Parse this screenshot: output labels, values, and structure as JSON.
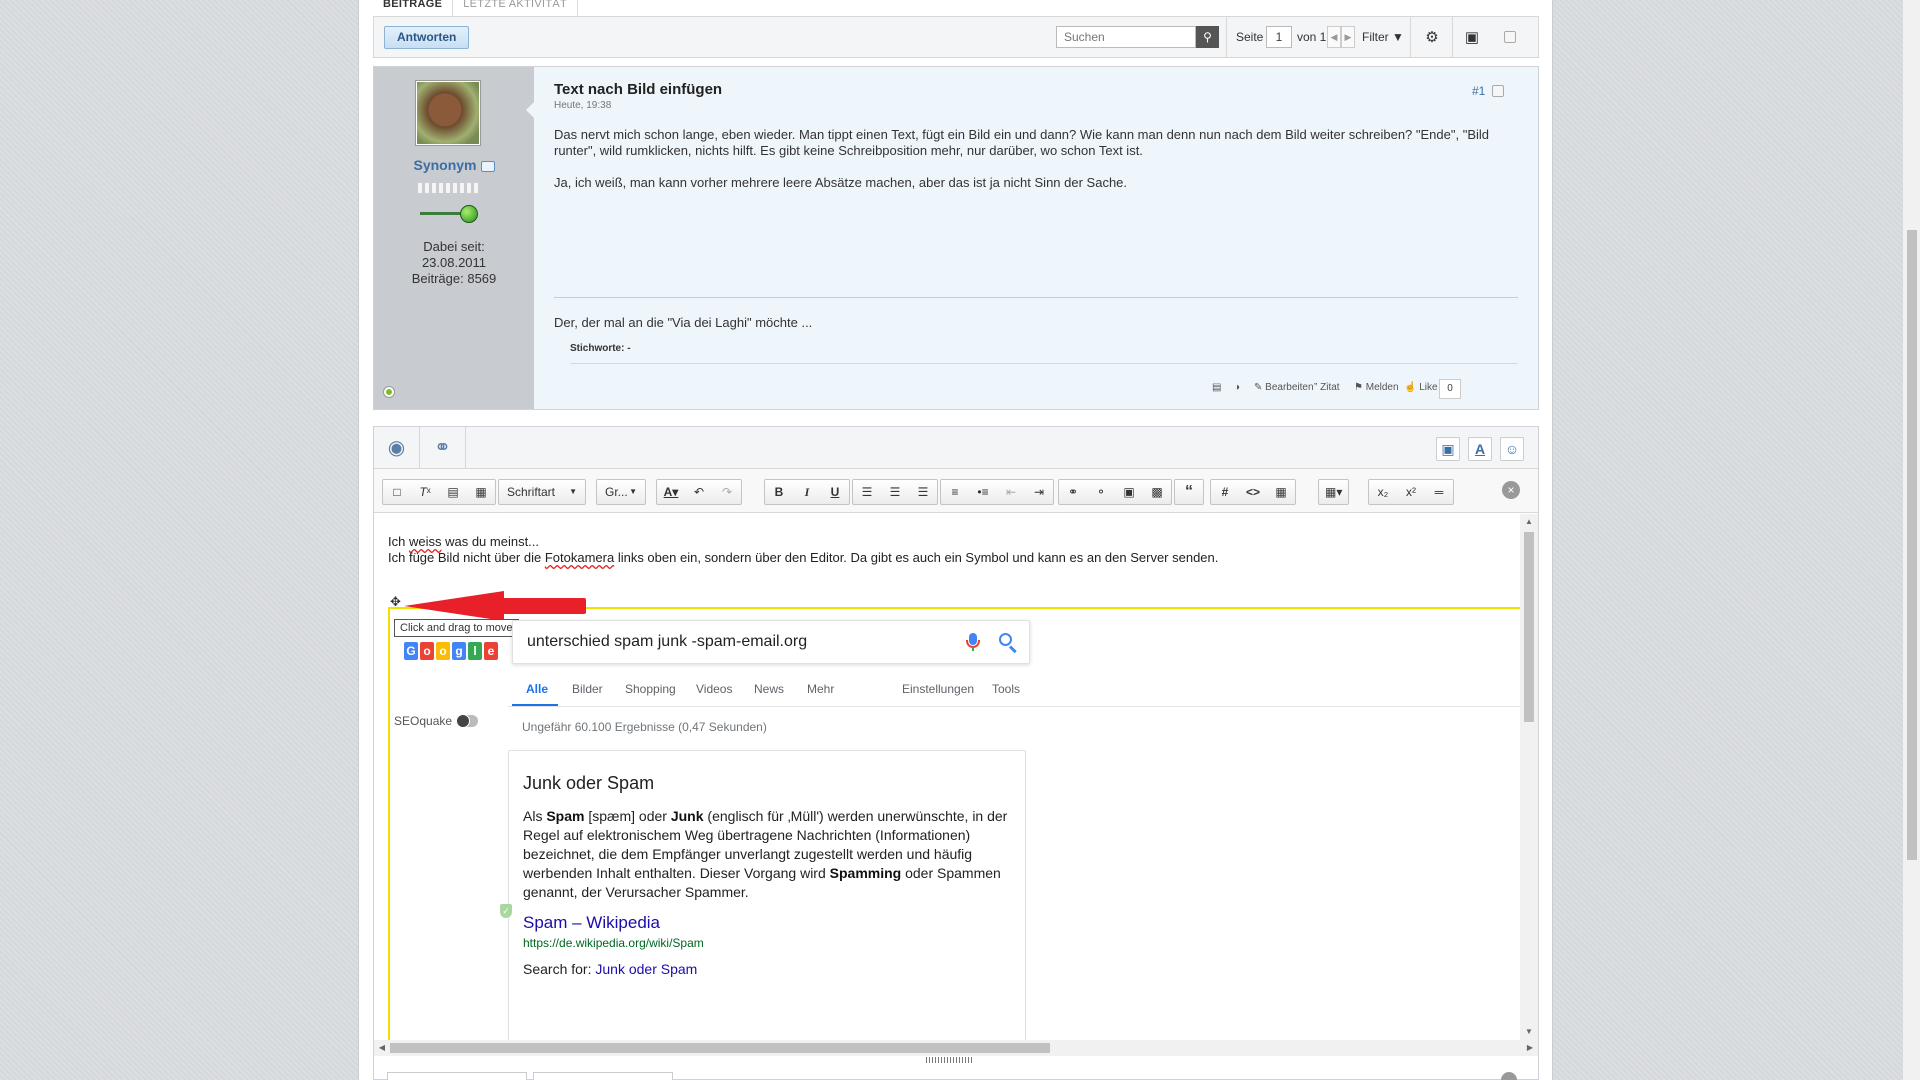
{
  "tabs": [
    "Beiträge",
    "Letzte Aktivität"
  ],
  "toolbar": {
    "reply_label": "Antworten",
    "search_placeholder": "Suchen",
    "page_label": "Seite",
    "page_value": "1",
    "of_label": "von 1",
    "filter_label": "Filter"
  },
  "post": {
    "username": "Synonym",
    "joined_label": "Dabei seit:",
    "joined_date": "23.08.2011",
    "posts_label": "Beiträge: 8569",
    "title": "Text nach Bild einfügen",
    "date": "Heute, 19:38",
    "number": "#1",
    "paragraphs": [
      "Das nervt mich schon lange, eben wieder. Man tippt einen Text, fügt ein Bild ein und dann? Wie kann man denn nun nach dem Bild weiter schreiben? \"Ende\", \"Bild runter\", wild rumklicken, nichts hilft. Es gibt keine Schreibposition mehr, nur darüber, wo schon Text ist.",
      "Ja, ich weiß, man kann vorher mehrere leere Absätze machen, aber das ist ja nicht Sinn der Sache."
    ],
    "signature": "Der, der mal an die \"Via dei Laghi\" möchte ...",
    "tags": "Stichworte: -",
    "actions": {
      "edit": "Bearbeiten",
      "quote": "Zitat",
      "report": "Melden",
      "like": "Like",
      "like_count": "0"
    }
  },
  "editor": {
    "font_dropdown": "Schriftart",
    "size_dropdown": "Gr...",
    "content_line1_a": "Ich ",
    "content_line1_sp": "weiss",
    "content_line1_b": " was du meinst...",
    "content_line2_a": "Ich füge Bild nicht über die ",
    "content_line2_sp": "Fotokamera",
    "content_line2_b": " links oben ein, sondern über den Editor. Da gibt es auch ein Symbol und kann es an den Server senden.",
    "tooltip": "Click and drag to move"
  },
  "google": {
    "query": "unterschied spam junk -spam-email.org",
    "tabs": [
      "Alle",
      "Bilder",
      "Shopping",
      "Videos",
      "News",
      "Mehr",
      "Einstellungen",
      "Tools"
    ],
    "seoquake": "SEOquake",
    "stats": "Ungefähr 60.100 Ergebnisse (0,47 Sekunden)",
    "kp_title": "Junk oder Spam",
    "kp_t1": "Als ",
    "kp_b1": "Spam",
    "kp_t2": " [spæm] oder ",
    "kp_b2": "Junk",
    "kp_t3": " (englisch für ‚Müll') werden unerwünschte, in der Regel auf elektronischem Weg übertragene Nachrichten (Informationen) bezeichnet, die dem Empfänger unverlangt zugestellt werden und häufig werbenden Inhalt enthalten. Dieser Vorgang wird ",
    "kp_b3": "Spamming",
    "kp_t4": " oder Spammen genannt, der Verursacher Spammer.",
    "kp_link": "Spam – Wikipedia",
    "kp_url": "https://de.wikipedia.org/wiki/Spam",
    "kp_more_label": "Search for: ",
    "kp_more_link": "Junk oder Spam"
  },
  "colors": {
    "accent": "#3a6ea5",
    "arrow": "#e8202a",
    "selection": "#f0e100",
    "google_blue": "#1a73e8",
    "link": "#1a0dab"
  }
}
